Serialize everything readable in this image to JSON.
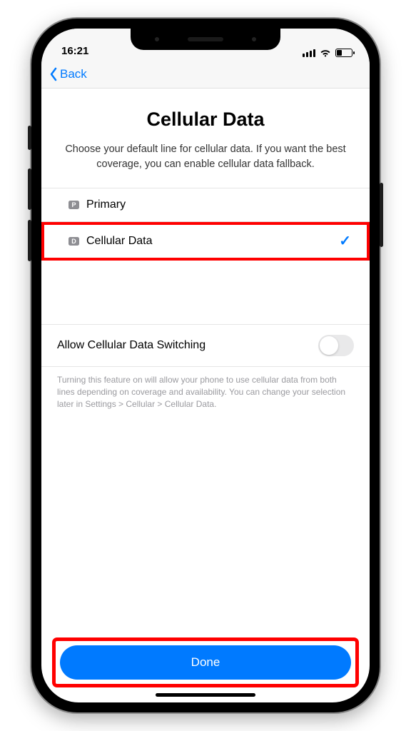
{
  "status": {
    "time": "16:21"
  },
  "nav": {
    "back_label": "Back"
  },
  "header": {
    "title": "Cellular Data",
    "subtitle": "Choose your default line for cellular data. If you want the best coverage, you can enable cellular data fallback."
  },
  "lines": [
    {
      "badge": "P",
      "label": "Primary",
      "selected": false,
      "highlighted": false
    },
    {
      "badge": "D",
      "label": "Cellular Data",
      "selected": true,
      "highlighted": true
    }
  ],
  "switch_row": {
    "label": "Allow Cellular Data Switching",
    "on": false
  },
  "footer_note": "Turning this feature on will allow your phone to use cellular data from both lines depending on coverage and availability. You can change your selection later in Settings > Cellular > Cellular Data.",
  "done_label": "Done"
}
